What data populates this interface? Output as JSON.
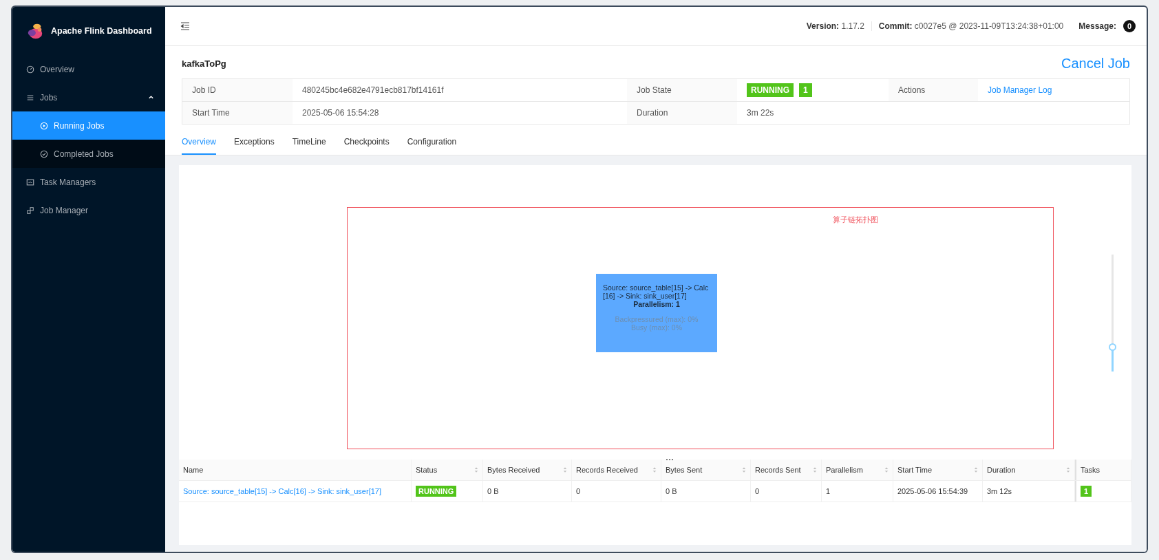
{
  "sidebar": {
    "brand": "Apache Flink Dashboard",
    "items": [
      {
        "label": "Overview",
        "selected": false
      },
      {
        "label": "Jobs",
        "selected": false,
        "expanded": true,
        "children": [
          {
            "label": "Running Jobs",
            "selected": true
          },
          {
            "label": "Completed Jobs",
            "selected": false
          }
        ]
      },
      {
        "label": "Task Managers",
        "selected": false
      },
      {
        "label": "Job Manager",
        "selected": false
      }
    ]
  },
  "header": {
    "items": [
      {
        "label": "Version:",
        "value": "1.17.2"
      },
      {
        "label": "Commit:",
        "value": "c0027e5 @ 2023-11-09T13:24:38+01:00"
      }
    ],
    "message_label": "Message:",
    "message_count": "0"
  },
  "job": {
    "name": "kafkaToPg",
    "cancel": "Cancel Job",
    "info": [
      [
        {
          "label": "Job ID",
          "kind": "text",
          "value": "480245bc4e682e4791ecb817bf14161f"
        },
        {
          "label": "Job State",
          "kind": "state",
          "value": "RUNNING",
          "count": "1"
        },
        {
          "label": "Actions",
          "kind": "link",
          "value": "Job Manager Log"
        }
      ],
      [
        {
          "label": "Start Time",
          "kind": "text",
          "value": "2025-05-06 15:54:28"
        },
        {
          "label": "Duration",
          "kind": "text",
          "value": "3m 22s"
        }
      ]
    ]
  },
  "tabs": [
    {
      "label": "Overview",
      "selected": true
    },
    {
      "label": "Exceptions",
      "selected": false
    },
    {
      "label": "TimeLine",
      "selected": false
    },
    {
      "label": "Checkpoints",
      "selected": false
    },
    {
      "label": "Configuration",
      "selected": false
    }
  ],
  "graph": {
    "annotation": "算子链拓扑图",
    "node": {
      "title": "Source: source_table[15] -> Calc[16] -> Sink: sink_user[17]",
      "parallelism": "Parallelism: 1",
      "backpressured": "Backpressured (max): 0%",
      "busy": "Busy (max): 0%"
    },
    "zoom": {
      "level": 0.2
    }
  },
  "table": {
    "columns": [
      {
        "label": "Name",
        "sortable": false
      },
      {
        "label": "Status",
        "sortable": true
      },
      {
        "label": "Bytes Received",
        "sortable": true
      },
      {
        "label": "Records Received",
        "sortable": true
      },
      {
        "label": "Bytes Sent",
        "sortable": true
      },
      {
        "label": "Records Sent",
        "sortable": true
      },
      {
        "label": "Parallelism",
        "sortable": true
      },
      {
        "label": "Start Time",
        "sortable": true
      },
      {
        "label": "Duration",
        "sortable": true
      },
      {
        "label": "Tasks",
        "sortable": false
      }
    ],
    "rows": [
      {
        "name": "Source: source_table[15] -> Calc[16] -> Sink: sink_user[17]",
        "status": "RUNNING",
        "bytes_received": "0 B",
        "records_received": "0",
        "bytes_sent": "0 B",
        "records_sent": "0",
        "parallelism": "1",
        "start_time": "2025-05-06 15:54:39",
        "duration": "3m 12s",
        "tasks": "1"
      }
    ]
  }
}
